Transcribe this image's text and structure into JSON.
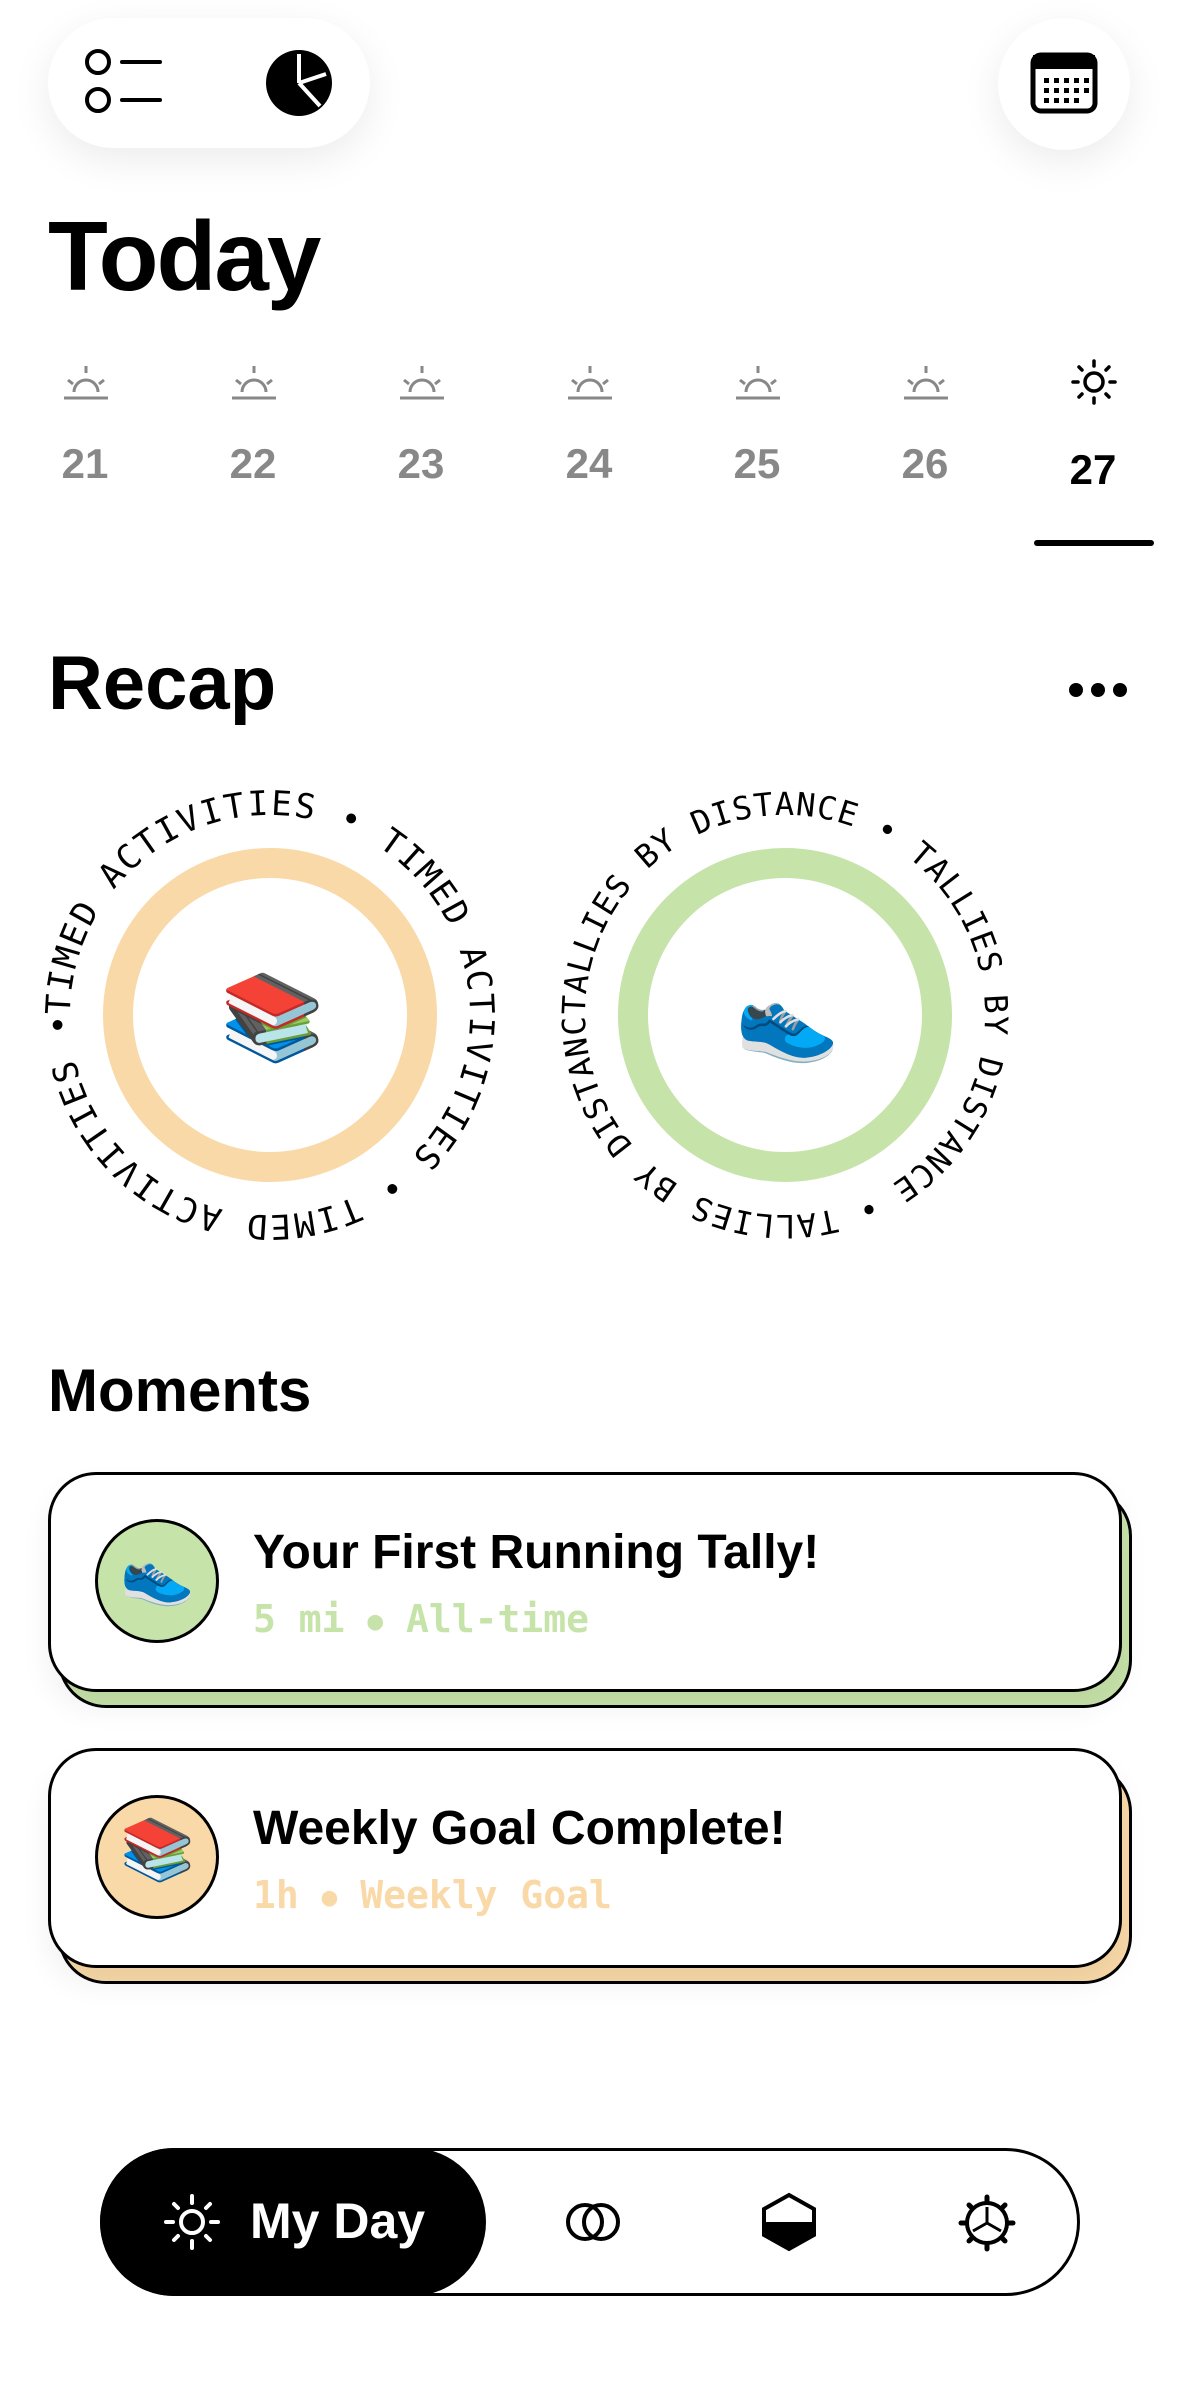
{
  "topbar": {
    "list_icon": "list-icon",
    "chart_icon": "pie-chart-icon",
    "calendar_icon": "calendar-icon"
  },
  "header": {
    "title": "Today"
  },
  "days": [
    {
      "num": "21",
      "icon": "sunrise-icon",
      "active": false
    },
    {
      "num": "22",
      "icon": "sunrise-icon",
      "active": false
    },
    {
      "num": "23",
      "icon": "sunrise-icon",
      "active": false
    },
    {
      "num": "24",
      "icon": "sunrise-icon",
      "active": false
    },
    {
      "num": "25",
      "icon": "sunrise-icon",
      "active": false
    },
    {
      "num": "26",
      "icon": "sunrise-icon",
      "active": false
    },
    {
      "num": "27",
      "icon": "sun-icon",
      "active": true
    }
  ],
  "recap": {
    "title": "Recap",
    "items": [
      {
        "label": "TIMED ACTIVITIES",
        "color": "#F9D9A8",
        "emoji": "📚"
      },
      {
        "label": "TALLIES BY DISTANCE",
        "color": "#C6E3A9",
        "emoji": "👟"
      }
    ]
  },
  "moments": {
    "title": "Moments",
    "cards": [
      {
        "title": "Your First Running Tally!",
        "value": "5 mi",
        "scope": "All-time",
        "color": "#C6E3A9",
        "emoji": "👟"
      },
      {
        "title": "Weekly Goal Complete!",
        "value": "1h",
        "scope": "Weekly Goal",
        "color": "#F9D9A8",
        "emoji": "📚"
      }
    ]
  },
  "nav": {
    "active_label": "My Day",
    "items": [
      "sun-icon",
      "rings-icon",
      "hexagon-icon",
      "gear-icon"
    ]
  }
}
